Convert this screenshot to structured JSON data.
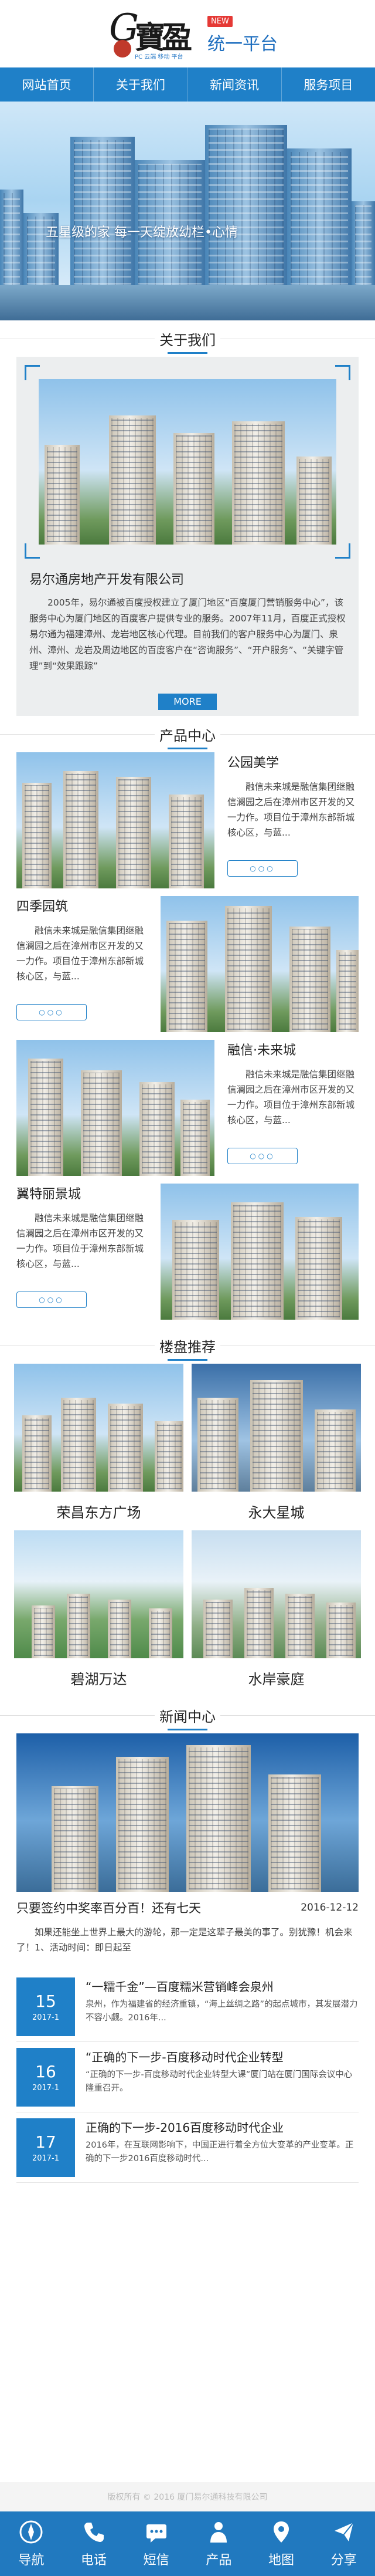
{
  "header": {
    "logo_letter": "G",
    "logo_cn": "寶盈",
    "logo_slogan": "PC 云端 移动 平台",
    "new_badge": "NEW",
    "platform_name": "统一平台"
  },
  "nav": [
    "网站首页",
    "关于我们",
    "新闻资讯",
    "服务项目"
  ],
  "banner": {
    "tagline": "五星级的家 每一天绽放幼栏•心情"
  },
  "about": {
    "title": "关于我们",
    "company": "易尔通房地产开发有限公司",
    "text": "2005年，易尔通被百度授权建立了厦门地区“百度厦门营销服务中心”，该服务中心为厦门地区的百度客户提供专业的服务。2007年11月，百度正式授权易尔通为福建漳州、龙岩地区核心代理。目前我们的客户服务中心为厦门、泉州、漳州、龙岩及周边地区的百度客户在“咨询服务”、“开户服务”、“关键字管理”到“效果跟踪”",
    "more": "MORE"
  },
  "products": {
    "title": "产品中心",
    "items": [
      {
        "name": "公园美学",
        "desc": "融信未来城是融信集团继融信澜园之后在漳州市区开发的又一力作。项目位于漳州东部新城核心区，与蓝..."
      },
      {
        "name": "四季园筑",
        "desc": "融信未来城是融信集团继融信澜园之后在漳州市区开发的又一力作。项目位于漳州东部新城核心区，与蓝..."
      },
      {
        "name": "融信·未来城",
        "desc": "融信未来城是融信集团继融信澜园之后在漳州市区开发的又一力作。项目位于漳州东部新城核心区，与蓝..."
      },
      {
        "name": "翼特丽景城",
        "desc": "融信未来城是融信集团继融信澜园之后在漳州市区开发的又一力作。项目位于漳州东部新城核心区，与蓝..."
      }
    ],
    "dots": "○○○"
  },
  "estates": {
    "title": "楼盘推荐",
    "items": [
      "荣昌东方广场",
      "永大星城",
      "碧湖万达",
      "水岸豪庭"
    ]
  },
  "news": {
    "title": "新闻中心",
    "main": {
      "title": "只要签约中奖率百分百！还有七天",
      "date": "2016-12-12",
      "excerpt": "如果还能坐上世界上最大的游轮，那一定是这辈子最美的事了。别犹豫！机会来了！1、活动时间：即日起至"
    },
    "list": [
      {
        "day": "15",
        "ym": "2017-1",
        "title": "“一糯千金”—百度糯米营销峰会泉州",
        "desc": "泉州，作为福建省的经济重镇，“海上丝绸之路”的起点城市，其发展潜力不容小觑。2016年..."
      },
      {
        "day": "16",
        "ym": "2017-1",
        "title": "“正确的下一步-百度移动时代企业转型",
        "desc": "“正确的下一步-百度移动时代企业转型大课”厦门站在厦门国际会议中心隆重召开。"
      },
      {
        "day": "17",
        "ym": "2017-1",
        "title": "正确的下一步-2016百度移动时代企业",
        "desc": "2016年，在互联网影响下，中国正进行着全方位大变革的产业变革。正确的下一步2016百度移动时代..."
      }
    ]
  },
  "footer": {
    "copyright": "版权所有 © 2016 厦门易尔通科技有限公司",
    "tabs": [
      {
        "label": "导航",
        "icon": "compass-icon"
      },
      {
        "label": "电话",
        "icon": "phone-icon"
      },
      {
        "label": "短信",
        "icon": "message-icon"
      },
      {
        "label": "产品",
        "icon": "product-icon"
      },
      {
        "label": "地图",
        "icon": "map-pin-icon"
      },
      {
        "label": "分享",
        "icon": "share-icon"
      }
    ]
  }
}
